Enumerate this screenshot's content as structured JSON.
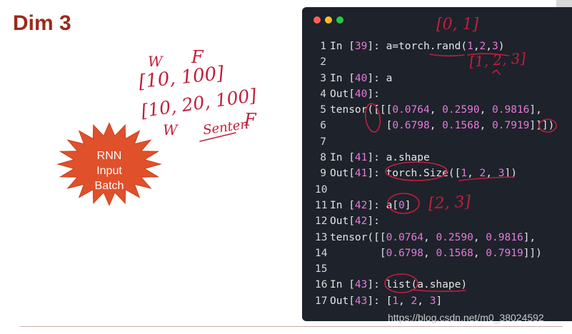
{
  "slide": {
    "title": "Dim 3",
    "starburst": {
      "line1": "RNN",
      "line2": "Input",
      "line3": "Batch",
      "color": "#e0502a"
    }
  },
  "handwriting": {
    "top_left": {
      "w": "W",
      "f": "F",
      "shape1": "[10, 100]",
      "shape2": "[10, 20, 100]",
      "w2": "W",
      "senten": "Senten",
      "f2": "F"
    },
    "code_notes": {
      "range": "[0, 1]",
      "dims": "[1, 2, 3]",
      "result": "[2, 3]"
    }
  },
  "code_window": {
    "lines": [
      {
        "n": "1",
        "text": "In [39]: a=torch.rand(1,2,3)"
      },
      {
        "n": "2",
        "text": ""
      },
      {
        "n": "3",
        "text": "In [40]: a"
      },
      {
        "n": "4",
        "text": "Out[40]:"
      },
      {
        "n": "5",
        "text": "tensor([[[0.0764, 0.2590, 0.9816],"
      },
      {
        "n": "6",
        "text": "         [0.6798, 0.1568, 0.7919]]])"
      },
      {
        "n": "7",
        "text": ""
      },
      {
        "n": "8",
        "text": "In [41]: a.shape"
      },
      {
        "n": "9",
        "text": "Out[41]: torch.Size([1, 2, 3])"
      },
      {
        "n": "10",
        "text": ""
      },
      {
        "n": "11",
        "text": "In [42]: a[0]"
      },
      {
        "n": "12",
        "text": "Out[42]:"
      },
      {
        "n": "13",
        "text": "tensor([[0.0764, 0.2590, 0.9816],"
      },
      {
        "n": "14",
        "text": "        [0.6798, 0.1568, 0.7919]])"
      },
      {
        "n": "15",
        "text": ""
      },
      {
        "n": "16",
        "text": "In [43]: list(a.shape)"
      },
      {
        "n": "17",
        "text": "Out[43]: [1, 2, 3]"
      }
    ],
    "colors": {
      "background": "#1e222b",
      "number": "#e37ad9",
      "text": "#e6e6e6"
    }
  },
  "watermark": "https://blog.csdn.net/m0_38024592"
}
